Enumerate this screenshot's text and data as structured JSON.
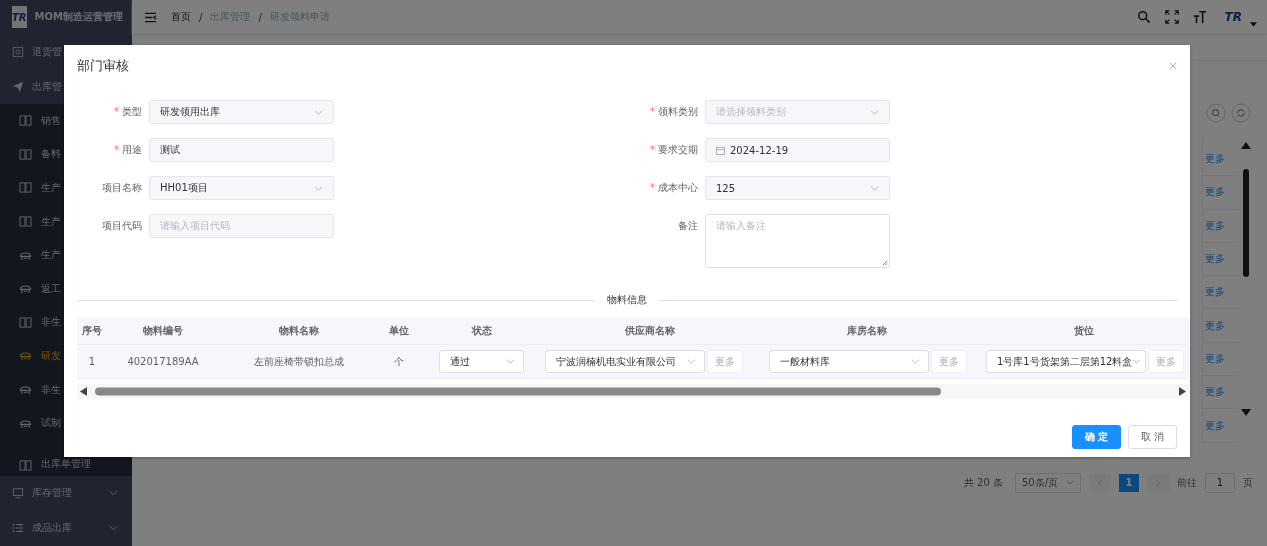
{
  "app": {
    "logo": "TR",
    "title": "MOM制造运营管理"
  },
  "sidebar": {
    "items": [
      {
        "label": "退货管",
        "kind": "return"
      },
      {
        "label": "出库管",
        "kind": "outbound",
        "expanded": true,
        "children": [
          {
            "label": "销售",
            "kind": "page",
            "selected": false
          },
          {
            "label": "备料",
            "kind": "page",
            "selected": false
          },
          {
            "label": "生产",
            "kind": "page",
            "selected": false
          },
          {
            "label": "生产",
            "kind": "page",
            "selected": false
          },
          {
            "label": "生产",
            "kind": "task",
            "selected": false
          },
          {
            "label": "返工",
            "kind": "task",
            "selected": false
          },
          {
            "label": "非生",
            "kind": "page",
            "selected": false
          },
          {
            "label": "研发",
            "kind": "task",
            "selected": true
          },
          {
            "label": "非生",
            "kind": "task",
            "selected": false
          },
          {
            "label": "试制",
            "kind": "task",
            "selected": false
          },
          {
            "label": "出库单管理",
            "kind": "page",
            "selected": false
          }
        ]
      },
      {
        "label": "库存管理",
        "kind": "stock",
        "expanded": false
      },
      {
        "label": "成品出库",
        "kind": "list",
        "expanded": false
      }
    ]
  },
  "header": {
    "breadcrumb": [
      "首页",
      "出库管理",
      "研发领料申请"
    ],
    "separator": "/",
    "avatar_logo": "TR"
  },
  "page": {
    "more_links": [
      "更多",
      "更多",
      "更多",
      "更多",
      "更多",
      "更多",
      "更多",
      "更多",
      "更多"
    ],
    "pagination": {
      "total": "共 20 条",
      "page_size": "50条/页",
      "pages": [
        {
          "label": "1",
          "selected": true
        }
      ],
      "goto_label": "前往",
      "goto_value": "1",
      "goto_unit": "页"
    }
  },
  "dialog": {
    "title": "部门审核",
    "required_mark": "*",
    "fields": [
      {
        "label": "类型",
        "required": true,
        "kind": "select",
        "value": "研发领用出库"
      },
      {
        "label": "领料类别",
        "required": true,
        "kind": "select",
        "placeholder": "请选择领料类别"
      },
      {
        "label": "用途",
        "required": true,
        "kind": "input",
        "value": "测试"
      },
      {
        "label": "要求交期",
        "required": true,
        "kind": "date",
        "value": "2024-12-19"
      },
      {
        "label": "项目名称",
        "required": false,
        "kind": "select",
        "value": "HH01项目"
      },
      {
        "label": "成本中心",
        "required": true,
        "kind": "select",
        "value": "125"
      },
      {
        "label": "项目代码",
        "required": false,
        "kind": "input",
        "placeholder": "请输入项目代码"
      },
      {
        "label": "备注",
        "required": false,
        "kind": "textarea",
        "placeholder": "请输入备注"
      }
    ],
    "section_title": "物料信息",
    "table": {
      "columns": [
        "序号",
        "物料编号",
        "物料名称",
        "单位",
        "状态",
        "供应商名称",
        "库房名称",
        "货位"
      ],
      "rows": [
        {
          "cells": [
            {
              "kind": "text",
              "value": "1"
            },
            {
              "kind": "text",
              "value": "402017189AA"
            },
            {
              "kind": "text",
              "value": "左前座椅带锁扣总成"
            },
            {
              "kind": "text",
              "value": "个"
            },
            {
              "kind": "select",
              "value": "通过"
            },
            {
              "kind": "select_more",
              "value": "宁波润楠机电实业有限公司",
              "more": "更多"
            },
            {
              "kind": "select_more",
              "value": "一般材料库",
              "more": "更多"
            },
            {
              "kind": "select_more",
              "value": "1号库1号货架第二层第12料盒",
              "more": "更多"
            }
          ]
        }
      ]
    },
    "buttons": [
      {
        "label": "确 定",
        "kind": "primary"
      },
      {
        "label": "取 消",
        "kind": "default"
      }
    ]
  }
}
